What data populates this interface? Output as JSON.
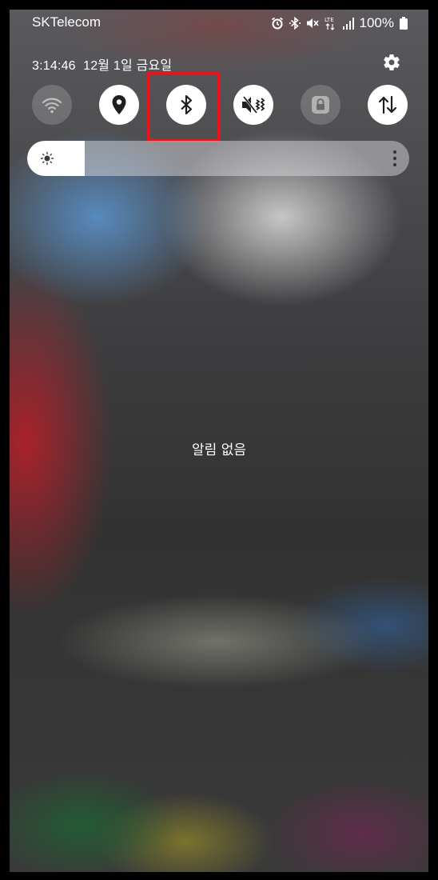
{
  "status_bar": {
    "carrier": "SKTelecom",
    "network_label": "LTE",
    "battery": "100%",
    "icons": [
      "alarm-icon",
      "bluetooth-icon",
      "mute-icon",
      "lte-data-icon",
      "signal-icon",
      "battery-icon"
    ]
  },
  "header": {
    "time": "3:14:46",
    "date": "12월 1일 금요일",
    "settings_icon": "gear-icon"
  },
  "quick_settings": {
    "tiles": [
      {
        "name": "wifi",
        "icon": "wifi-icon",
        "state": "off"
      },
      {
        "name": "location",
        "icon": "location-pin-icon",
        "state": "on"
      },
      {
        "name": "bluetooth",
        "icon": "bluetooth-icon",
        "state": "on"
      },
      {
        "name": "sound",
        "icon": "mute-vibrate-icon",
        "state": "on"
      },
      {
        "name": "screen-lock",
        "icon": "lock-icon",
        "state": "off"
      },
      {
        "name": "mobile-data",
        "icon": "data-transfer-icon",
        "state": "on"
      }
    ],
    "highlighted_tile": "bluetooth"
  },
  "brightness": {
    "level": 0.15,
    "icon": "sun-icon",
    "menu_icon": "more-vertical-icon"
  },
  "notifications": {
    "empty_text": "알림 없음"
  },
  "colors": {
    "highlight": "#e8141d",
    "tile_on": "#ffffff",
    "icon_dark": "#1f1f1f"
  }
}
